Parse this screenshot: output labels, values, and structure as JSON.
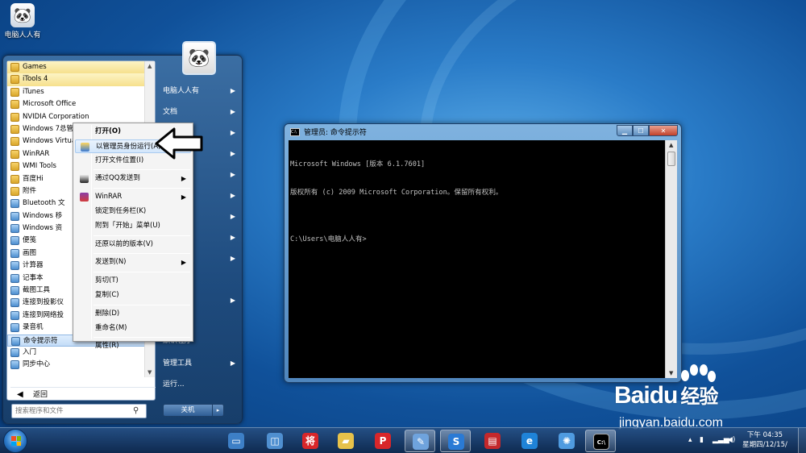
{
  "desktop": {
    "icon_label": "电脑人人有",
    "accent": "#1a5fa8"
  },
  "start_menu": {
    "programs": [
      {
        "label": "Games",
        "kind": "folder",
        "state": "hl"
      },
      {
        "label": "iTools 4",
        "kind": "folder",
        "state": "hl"
      },
      {
        "label": "iTunes",
        "kind": "folder"
      },
      {
        "label": "Microsoft Office",
        "kind": "folder"
      },
      {
        "label": "NVIDIA Corporation",
        "kind": "folder"
      },
      {
        "label": "Windows 7总管",
        "kind": "folder"
      },
      {
        "label": "Windows Virtua",
        "kind": "folder"
      },
      {
        "label": "WinRAR",
        "kind": "folder"
      },
      {
        "label": "WMI Tools",
        "kind": "folder"
      },
      {
        "label": "百度Hi",
        "kind": "folder"
      },
      {
        "label": "附件",
        "kind": "folder"
      },
      {
        "label": "Bluetooth 文",
        "kind": "app",
        "indent": true
      },
      {
        "label": "Windows 移",
        "kind": "app",
        "indent": true
      },
      {
        "label": "Windows 资",
        "kind": "app",
        "indent": true
      },
      {
        "label": "便笺",
        "kind": "app",
        "indent": true
      },
      {
        "label": "画图",
        "kind": "app",
        "indent": true
      },
      {
        "label": "计算器",
        "kind": "app",
        "indent": true
      },
      {
        "label": "记事本",
        "kind": "app",
        "indent": true
      },
      {
        "label": "截图工具",
        "kind": "app",
        "indent": true
      },
      {
        "label": "连接到投影仪",
        "kind": "app",
        "indent": true
      },
      {
        "label": "连接到网络投",
        "kind": "app",
        "indent": true
      },
      {
        "label": "录音机",
        "kind": "app",
        "indent": true
      },
      {
        "label": "命令提示符",
        "kind": "app",
        "indent": true,
        "state": "sel"
      },
      {
        "label": "入门",
        "kind": "app",
        "indent": true
      },
      {
        "label": "同步中心",
        "kind": "app",
        "indent": true
      }
    ],
    "back_label": "返回",
    "search_placeholder": "搜索程序和文件",
    "right_items": [
      {
        "label": "电脑人人有",
        "chevron": true
      },
      {
        "label": "文档",
        "chevron": true
      },
      {
        "label": "",
        "chevron": true
      },
      {
        "label": "",
        "chevron": true
      },
      {
        "label": "",
        "chevron": true
      },
      {
        "label": "",
        "chevron": true
      },
      {
        "label": "",
        "chevron": true
      },
      {
        "label": "",
        "chevron": true
      },
      {
        "label": "",
        "chevron": true
      },
      {
        "label": "",
        "chevron": true
      },
      {
        "label": "机",
        "chevron": false
      },
      {
        "label": "默认程序",
        "chevron": false
      },
      {
        "label": "管理工具",
        "chevron": true
      },
      {
        "label": "运行...",
        "chevron": false
      }
    ],
    "shutdown_label": "关机",
    "shutdown_arrow": "▸"
  },
  "context_menu": {
    "items": [
      {
        "label": "打开(O)",
        "bold": true
      },
      {
        "label": "以管理员身份运行(A)",
        "highlighted": true,
        "icon": "shield-icon"
      },
      {
        "label": "打开文件位置(I)"
      },
      {
        "sep": true
      },
      {
        "label": "通过QQ发送到",
        "submenu": true,
        "icon": "qq-icon"
      },
      {
        "sep": true
      },
      {
        "label": "WinRAR",
        "submenu": true,
        "icon": "winrar-icon"
      },
      {
        "label": "锁定到任务栏(K)"
      },
      {
        "label": "附到「开始」菜单(U)"
      },
      {
        "sep": true
      },
      {
        "label": "还原以前的版本(V)"
      },
      {
        "sep": true
      },
      {
        "label": "发送到(N)",
        "submenu": true
      },
      {
        "sep": true
      },
      {
        "label": "剪切(T)"
      },
      {
        "label": "复制(C)"
      },
      {
        "sep": true
      },
      {
        "label": "删除(D)"
      },
      {
        "label": "重命名(M)"
      },
      {
        "sep": true
      },
      {
        "label": "属性(R)"
      }
    ]
  },
  "cmd_window": {
    "title": "管理员: 命令提示符",
    "icon_text": "C:\\",
    "lines": [
      "Microsoft Windows [版本 6.1.7601]",
      "版权所有 (c) 2009 Microsoft Corporation。保留所有权利。",
      "",
      "C:\\Users\\电脑人人有>"
    ],
    "min_glyph": "▁",
    "max_glyph": "☐",
    "close_glyph": "✕"
  },
  "taskbar": {
    "buttons": [
      {
        "name": "desktop-preview-app",
        "glyph": "▭",
        "color": "#3d7fc6"
      },
      {
        "name": "network-app",
        "glyph": "◫",
        "color": "#4f8fd0"
      },
      {
        "name": "chinese-chess-app",
        "glyph": "将",
        "color": "#d8262a"
      },
      {
        "name": "folder-app",
        "glyph": "▰",
        "color": "#e7c24a"
      },
      {
        "name": "p-app",
        "glyph": "P",
        "color": "#d8262a"
      },
      {
        "name": "paint-app",
        "glyph": "✎",
        "color": "#6fa3dd",
        "active": true
      },
      {
        "name": "s-app",
        "glyph": "S",
        "color": "#2a7ad5",
        "active": true
      },
      {
        "name": "pdf-app",
        "glyph": "▤",
        "color": "#c4282b"
      },
      {
        "name": "ie-app",
        "glyph": "e",
        "color": "#1f83d8"
      },
      {
        "name": "gear-app",
        "glyph": "✺",
        "color": "#4f9be0"
      },
      {
        "name": "cmd-app",
        "glyph": "C:\\",
        "color": "#000000",
        "active": true
      }
    ],
    "clock_time": "下午 04:35",
    "clock_date": "星期四/12/15/"
  },
  "watermark": {
    "logo": "Bai",
    "logo_du": "du",
    "logo_cn": "经验",
    "url": "jingyan.baidu.com"
  }
}
